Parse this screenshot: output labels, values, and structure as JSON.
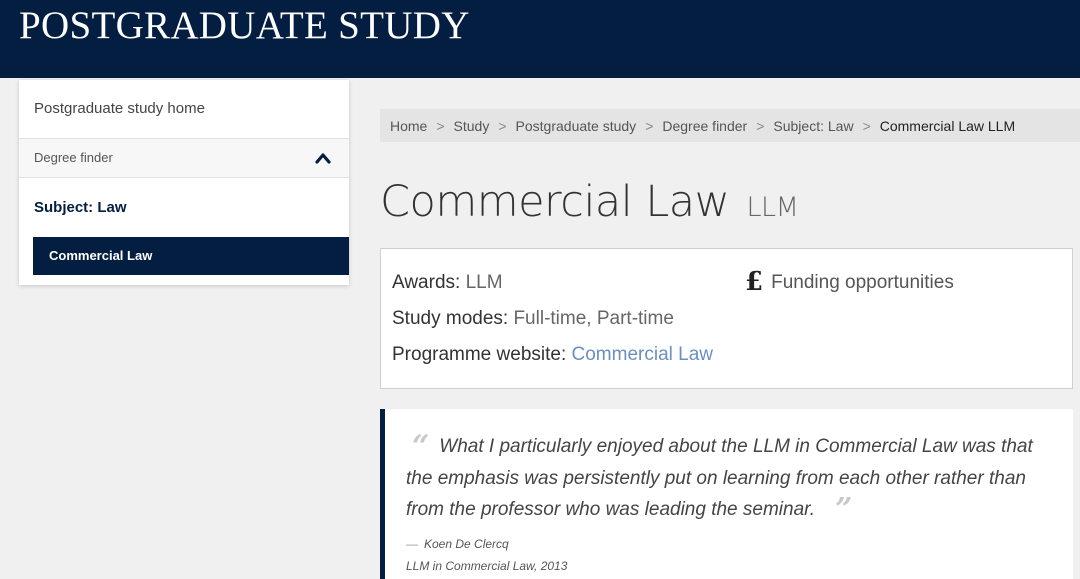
{
  "header": {
    "title": "POSTGRADUATE STUDY"
  },
  "sidebar": {
    "home": "Postgraduate study home",
    "finder": "Degree finder",
    "subject": "Subject: Law",
    "active": "Commercial Law",
    "chevron_icon": "chevron-up-icon"
  },
  "breadcrumb": {
    "items": [
      "Home",
      "Study",
      "Postgraduate study",
      "Degree finder",
      "Subject: Law"
    ],
    "current": "Commercial Law LLM",
    "separator": ">"
  },
  "page": {
    "title": "Commercial Law",
    "award": "LLM"
  },
  "info": {
    "awards_label": "Awards:",
    "awards_value": "LLM",
    "modes_label": "Study modes:",
    "modes_value": "Full-time, Part-time",
    "website_label": "Programme website:",
    "website_value": "Commercial Law",
    "funding_symbol": "£",
    "funding_label": "Funding opportunities"
  },
  "quote": {
    "open_mark": "“",
    "close_mark": "”",
    "text": "What I particularly enjoyed about the LLM in Commercial Law was that the emphasis was persistently put on learning from each other rather than from the professor who was leading the seminar.",
    "author_dash": "—",
    "author": "Koen De Clercq",
    "course": "LLM in Commercial Law, 2013"
  },
  "colors": {
    "brand_navy": "#041e42",
    "link": "#6a8fc0",
    "page_bg": "#f0f0f0"
  }
}
